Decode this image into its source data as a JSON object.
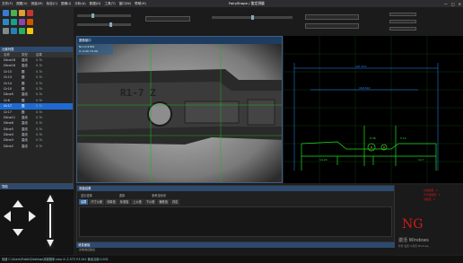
{
  "app": {
    "title": "FairyShape / 鉴定测量"
  },
  "menu": [
    "文件(F)",
    "视图(V)",
    "测量(M)",
    "标定(C)",
    "图像(I)",
    "分析(A)",
    "数据(D)",
    "工具(T)",
    "窗口(W)",
    "帮助(H)"
  ],
  "window_controls": [
    "—",
    "□",
    "✕"
  ],
  "left_panel": {
    "title": "元素列表",
    "columns": [
      "名称",
      "类型",
      "结果"
    ],
    "rows": [
      {
        "name": "Dline18",
        "type": "直线",
        "value": "0.7k"
      },
      {
        "name": "Dline16",
        "type": "直线",
        "value": "0.7k"
      },
      {
        "name": "Cir15",
        "type": "圆",
        "value": "0.7k"
      },
      {
        "name": "Cir13",
        "type": "圆",
        "value": "0.7k"
      },
      {
        "name": "Cir14",
        "type": "圆",
        "value": "0.7k"
      },
      {
        "name": "Cir10",
        "type": "圆",
        "value": "0.7k"
      },
      {
        "name": "Dline9",
        "type": "直线",
        "value": "0.7k"
      },
      {
        "name": "Cir8",
        "type": "圆",
        "value": "0.7k"
      },
      {
        "name": "Cir17",
        "type": "圆",
        "value": "0.7k",
        "selected": true
      },
      {
        "name": "Cir17",
        "type": "圆",
        "value": "0.7k"
      },
      {
        "name": "Dline11",
        "type": "直线",
        "value": "0.7k"
      },
      {
        "name": "Dline6",
        "type": "直线",
        "value": "0.7k"
      },
      {
        "name": "Dline5",
        "type": "直线",
        "value": "0.7k"
      },
      {
        "name": "Dline4",
        "type": "直线",
        "value": "0.7k"
      },
      {
        "name": "Dline3",
        "type": "直线",
        "value": "0.7k"
      },
      {
        "name": "Dline2",
        "type": "直线",
        "value": "0.7k"
      }
    ]
  },
  "nav_panel": {
    "title": "导航"
  },
  "image_window": {
    "title": "图像窗口",
    "overlay_text": [
      "Ncc:0.9784",
      "X:-0.00 Y:0.00"
    ],
    "part_label": "R1-7  Z"
  },
  "plot_window": {
    "dims": [
      "121.572",
      "102.614",
      "14.20",
      "8.48",
      "5.10",
      "12.7"
    ]
  },
  "result_panel": {
    "title": "测量结果",
    "tabs": [
      "结果",
      "尺寸公差",
      "测量值",
      "标准值",
      "上公差",
      "下公差",
      "偏差值",
      "判定"
    ],
    "top_fields": [
      "显示选择",
      "选择",
      "参考坐标系"
    ]
  },
  "ng_panel": {
    "label": "NG",
    "stats": [
      "合格数量：0",
      "不合格数量：0",
      "总数量：0"
    ],
    "activate": [
      "激活 Windows",
      "转到“设置”以激活 Windows。"
    ]
  },
  "message_panel": {
    "title": "消息面板",
    "sub": "系统消息输出"
  },
  "status": {
    "text": "就绪  C:\\Users\\Public\\Desktop\\测量程序.vmp  X:-2.573  Y:3.541  像素当量:0.002"
  },
  "colors": {
    "accent": "#1f6ad1",
    "ng": "#d01a1a",
    "plot_line": "#22dd22",
    "dim_line": "#2a8cff"
  }
}
